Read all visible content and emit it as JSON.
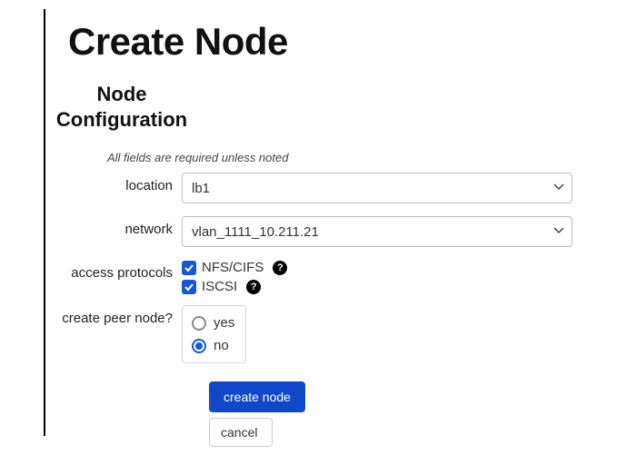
{
  "page": {
    "title": "Create Node"
  },
  "section": {
    "title": "Node Configuration",
    "hint": "All fields are required unless noted"
  },
  "form": {
    "location": {
      "label": "location",
      "value": "lb1"
    },
    "network": {
      "label": "network",
      "value": "vlan_1111_10.211.21"
    },
    "access_protocols": {
      "label": "access protocols",
      "options": [
        {
          "label": "NFS/CIFS",
          "checked": true
        },
        {
          "label": "ISCSI",
          "checked": true
        }
      ]
    },
    "peer_node": {
      "label": "create peer node?",
      "options": [
        {
          "label": "yes",
          "selected": false
        },
        {
          "label": "no",
          "selected": true
        }
      ]
    }
  },
  "actions": {
    "submit": "create node",
    "cancel": "cancel"
  }
}
